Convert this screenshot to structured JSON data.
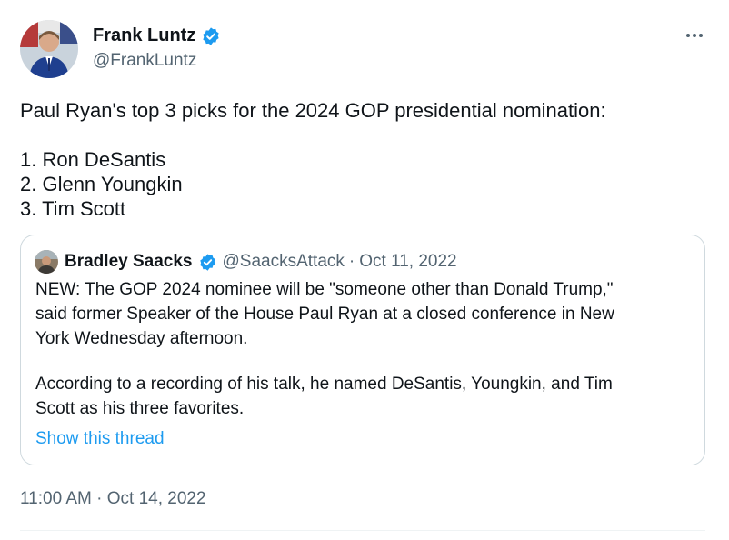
{
  "author": {
    "name": "Frank Luntz",
    "handle": "@FrankLuntz",
    "verified_icon": "verified-badge-icon"
  },
  "tweet": {
    "lines": [
      "Paul Ryan's top 3 picks for the 2024 GOP presidential nomination:",
      "1. Ron DeSantis",
      "2. Glenn Youngkin",
      "3. Tim Scott"
    ],
    "timestamp": "11:00 AM · Oct 14, 2022"
  },
  "quoted": {
    "name": "Bradley Saacks",
    "handle": "@SaacksAttack",
    "separator": "·",
    "date": "Oct 11, 2022",
    "lines": [
      "NEW: The GOP 2024 nominee will be \"someone other than Donald Trump,\"",
      "said former Speaker of the House Paul Ryan at a closed conference in New",
      "York Wednesday afternoon.",
      "According to a recording of his talk, he named DeSantis, Youngkin, and Tim",
      "Scott as his three favorites."
    ],
    "show_thread": "Show this thread"
  },
  "colors": {
    "text": "#0f1419",
    "secondary": "#536471",
    "link": "#1d9bf0",
    "border": "#cfd9de"
  }
}
